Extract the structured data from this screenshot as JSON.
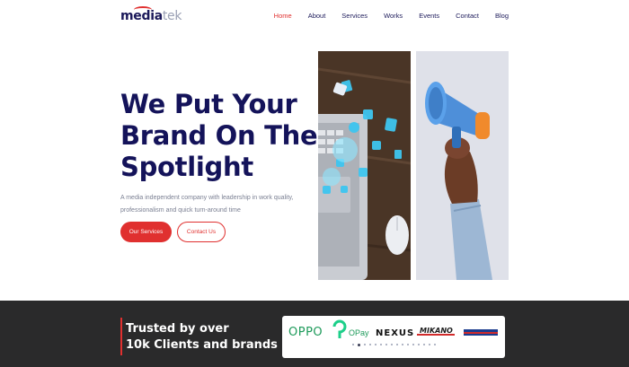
{
  "brand": {
    "logo_part1": "media",
    "logo_part2": "tek"
  },
  "nav": {
    "items": [
      {
        "label": "Home",
        "active": true
      },
      {
        "label": "About"
      },
      {
        "label": "Services"
      },
      {
        "label": "Works"
      },
      {
        "label": "Events"
      },
      {
        "label": "Contact"
      },
      {
        "label": "Blog"
      }
    ]
  },
  "hero": {
    "title_line1": "We Put Your",
    "title_line2": "Brand On The",
    "title_line3": "Spotlight",
    "description_line1": "A media independent company with leadership in work quality,",
    "description_line2": "professionalism and quick turn-around time",
    "primary_button": "Our Services",
    "secondary_button": "Contact Us"
  },
  "trust": {
    "line1": "Trusted by over",
    "line2": "10k Clients and brands",
    "logos": [
      "OPPO",
      "OPay",
      "NEXUS",
      "MIKANO"
    ]
  },
  "colors": {
    "accent": "#e0302f",
    "navy": "#14135a",
    "dark_band": "#2a2a2b"
  }
}
